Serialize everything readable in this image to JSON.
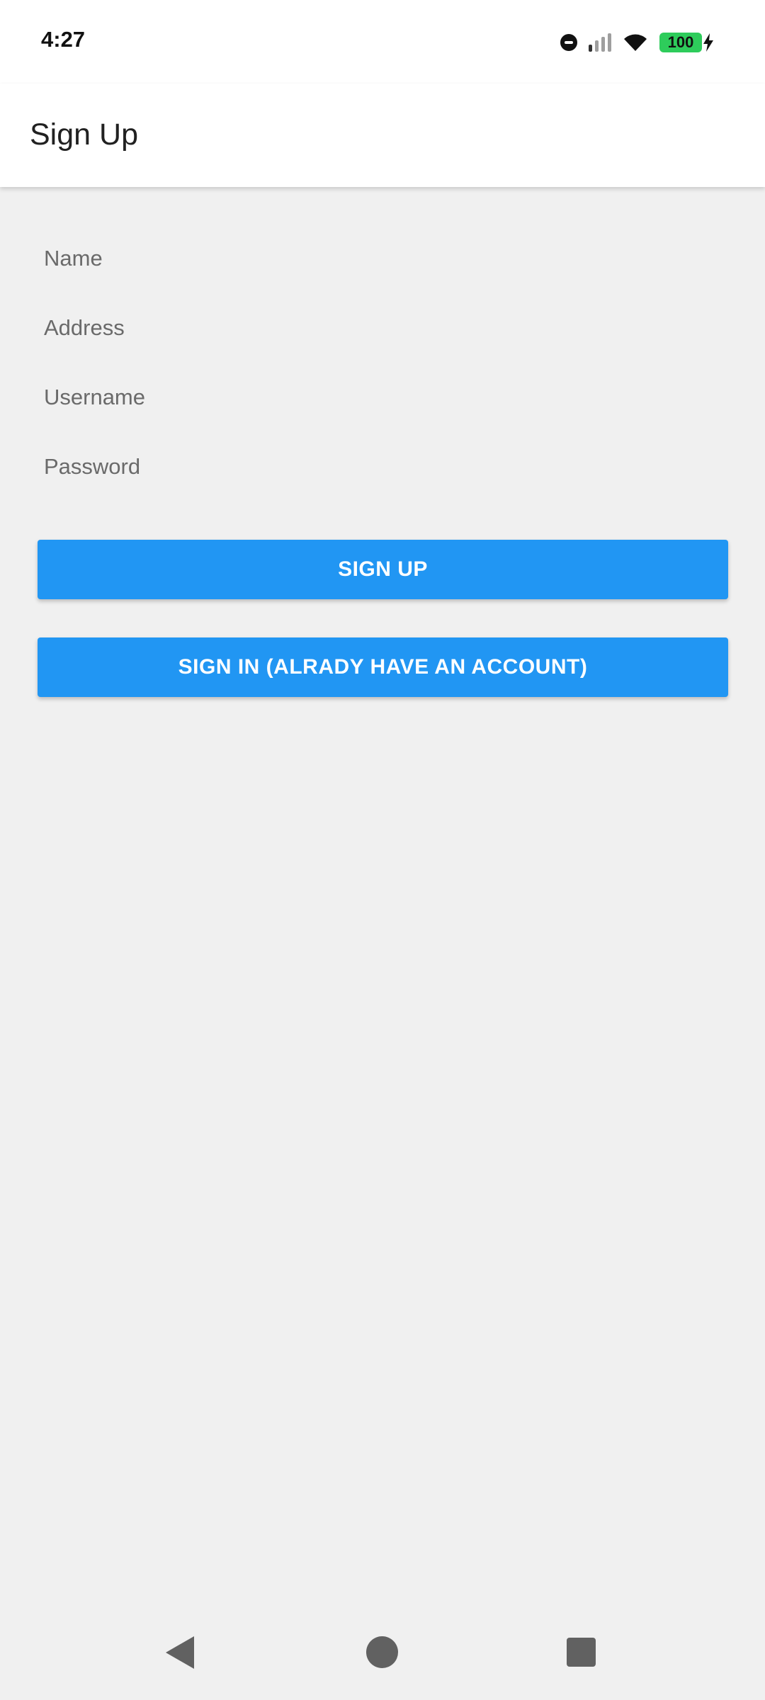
{
  "status_bar": {
    "time": "4:27",
    "battery": "100",
    "icons": [
      "do-not-disturb-icon",
      "signal-icon",
      "wifi-icon",
      "battery-icon",
      "charging-bolt-icon"
    ]
  },
  "app_bar": {
    "title": "Sign Up"
  },
  "form": {
    "name_placeholder": "Name",
    "address_placeholder": "Address",
    "username_placeholder": "Username",
    "password_placeholder": "Password"
  },
  "buttons": {
    "sign_up": "SIGN UP",
    "sign_in": "SIGN IN (ALRADY HAVE AN ACCOUNT)"
  },
  "nav_bar": {
    "icons": [
      "back-icon",
      "home-icon",
      "recents-icon"
    ]
  },
  "colors": {
    "accent": "#2196f3",
    "background": "#f0f0f0",
    "app_bar": "#ffffff",
    "battery": "#2ecc5b"
  }
}
